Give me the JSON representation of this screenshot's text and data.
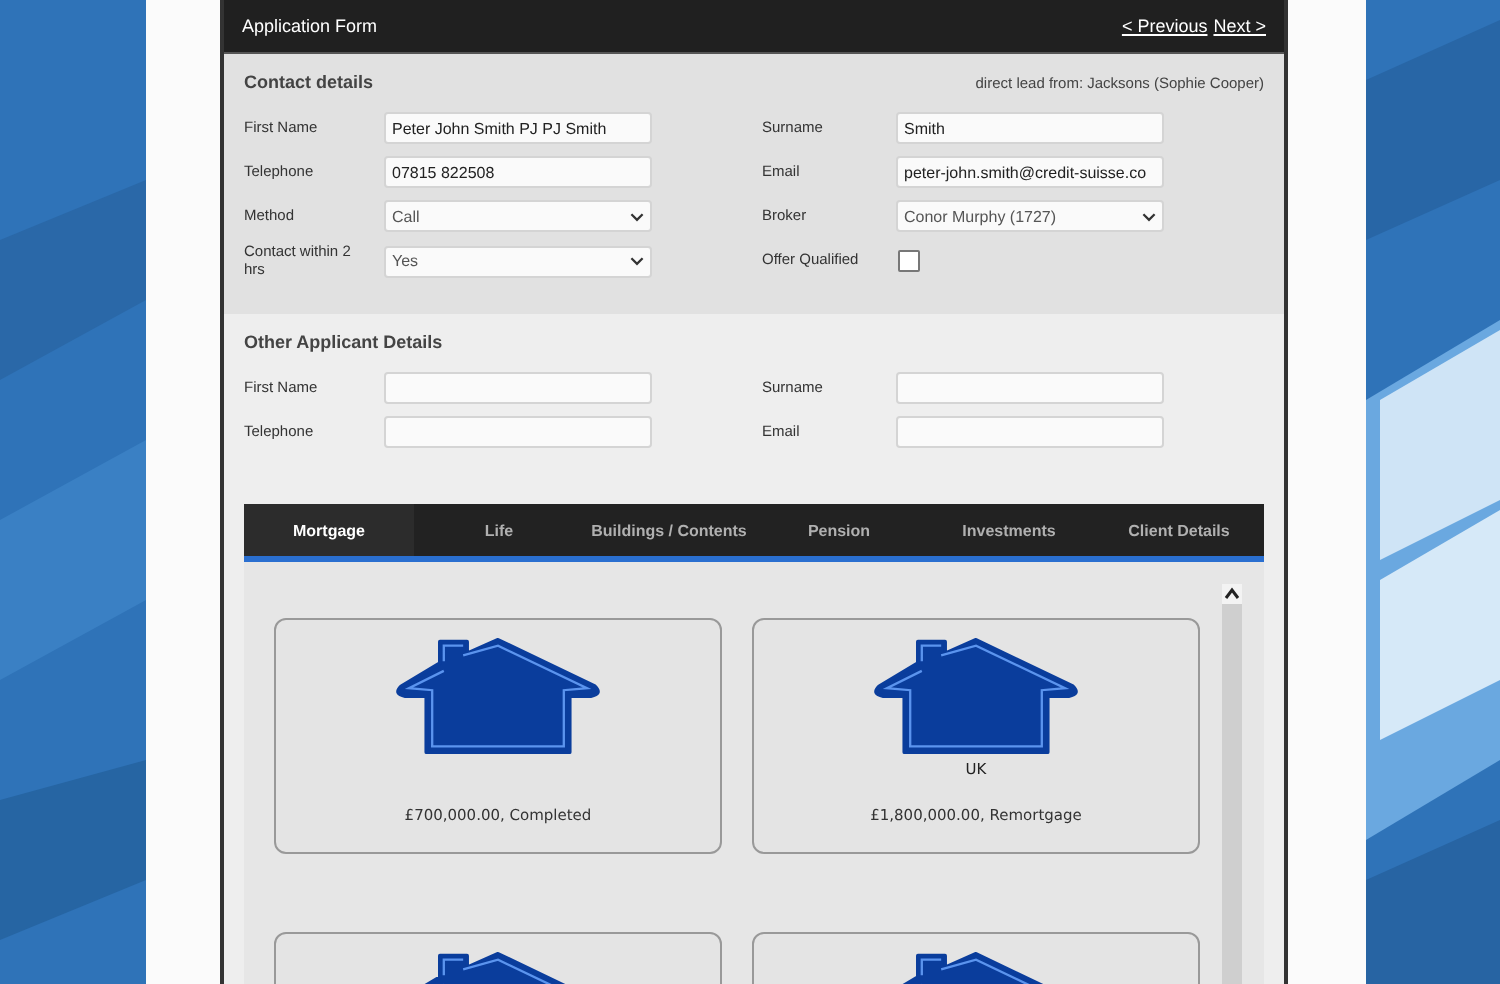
{
  "header": {
    "title": "Application Form",
    "links": [
      {
        "label": "< Previous"
      },
      {
        "label": "Next >"
      }
    ]
  },
  "contact": {
    "title": "Contact details",
    "lead": "direct lead from: Jacksons (Sophie Cooper)",
    "fields": [
      {
        "label": "First Name",
        "kind": "text",
        "value": "Peter John Smith PJ PJ Smith"
      },
      {
        "label": "Surname",
        "kind": "text",
        "value": "Smith"
      },
      {
        "label": "Telephone",
        "kind": "text",
        "value": "07815 822508"
      },
      {
        "label": "Email",
        "kind": "text",
        "value": "peter-john.smith@credit-suisse.co"
      },
      {
        "label": "Method",
        "kind": "select",
        "value": "Call"
      },
      {
        "label": "Broker",
        "kind": "select",
        "value": "Conor Murphy (1727)"
      },
      {
        "label": "Contact within 2 hrs",
        "kind": "select",
        "value": "Yes"
      },
      {
        "label": "Offer Qualified",
        "kind": "checkbox",
        "checked": false
      }
    ]
  },
  "other_applicant": {
    "title": "Other Applicant Details",
    "fields": [
      {
        "label": "First Name",
        "kind": "text"
      },
      {
        "label": "Surname",
        "kind": "text"
      },
      {
        "label": "Telephone",
        "kind": "text"
      },
      {
        "label": "Email",
        "kind": "text"
      }
    ]
  },
  "tabs": [
    {
      "label": "Mortgage",
      "selected": true
    },
    {
      "label": "Life",
      "selected": false
    },
    {
      "label": "Buildings / Contents",
      "selected": false
    },
    {
      "label": "Pension",
      "selected": false
    },
    {
      "label": "Investments",
      "selected": false
    },
    {
      "label": "Client Details",
      "selected": false
    }
  ],
  "cards": [
    {
      "kind": "house",
      "caption": "£700,000.00, Completed"
    },
    {
      "kind": "house",
      "location": "UK",
      "caption": "£1,800,000.00, Remortgage"
    },
    {
      "kind": "house"
    },
    {
      "kind": "house"
    }
  ]
}
